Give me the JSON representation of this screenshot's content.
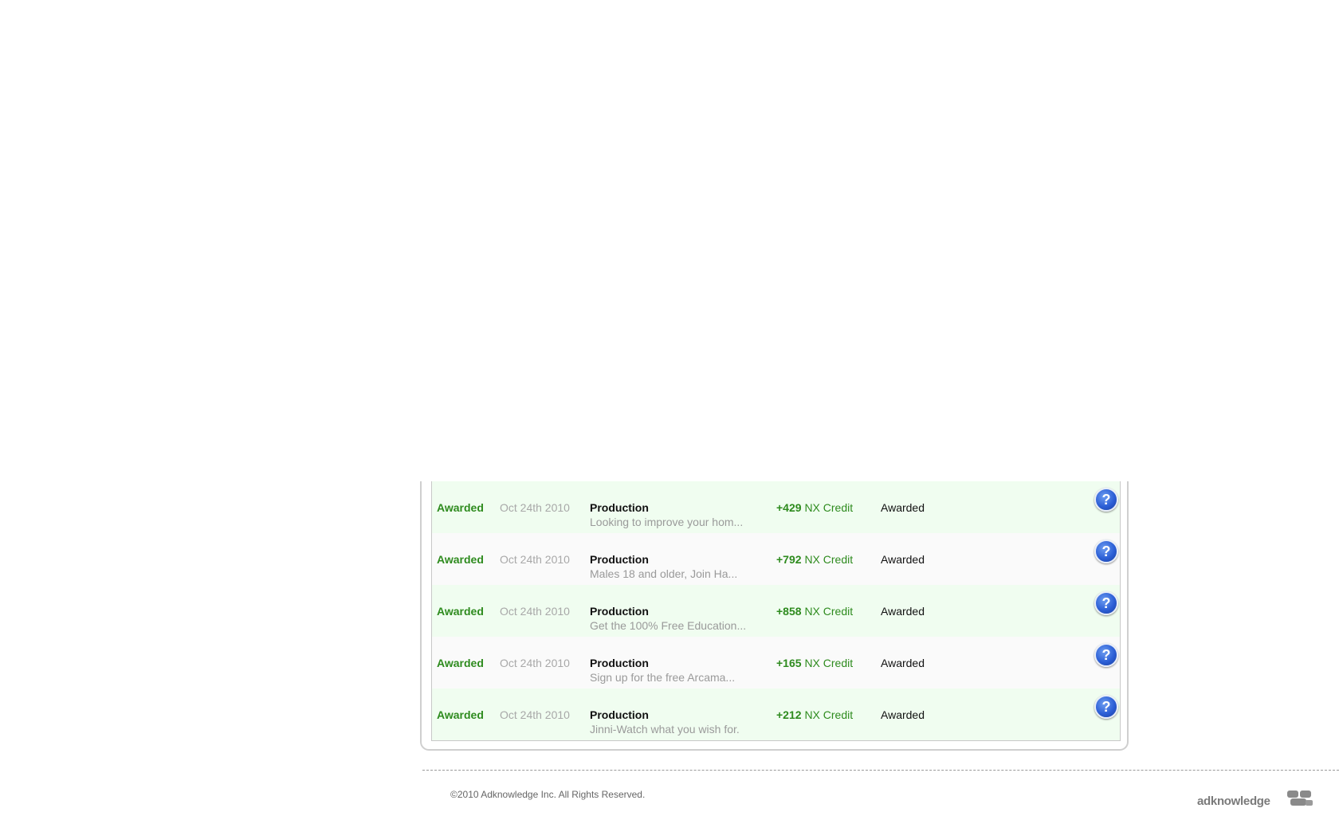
{
  "rows": [
    {
      "status": "Awarded",
      "date": "Oct 24th 2010",
      "offer_name": "Production",
      "offer_desc": "Looking to improve your hom...",
      "credit_amount": "+429",
      "credit_unit": "NX Credit",
      "credit_status": "Awarded",
      "help_icon": "?"
    },
    {
      "status": "Awarded",
      "date": "Oct 24th 2010",
      "offer_name": "Production",
      "offer_desc": "Males 18 and older, Join Ha...",
      "credit_amount": "+792",
      "credit_unit": "NX Credit",
      "credit_status": "Awarded",
      "help_icon": "?"
    },
    {
      "status": "Awarded",
      "date": "Oct 24th 2010",
      "offer_name": "Production",
      "offer_desc": "Get the 100% Free Education...",
      "credit_amount": "+858",
      "credit_unit": "NX Credit",
      "credit_status": "Awarded",
      "help_icon": "?"
    },
    {
      "status": "Awarded",
      "date": "Oct 24th 2010",
      "offer_name": "Production",
      "offer_desc": "Sign up for the free Arcama...",
      "credit_amount": "+165",
      "credit_unit": "NX Credit",
      "credit_status": "Awarded",
      "help_icon": "?"
    },
    {
      "status": "Awarded",
      "date": "Oct 24th 2010",
      "offer_name": "Production",
      "offer_desc": "Jinni-Watch what you wish for.",
      "credit_amount": "+212",
      "credit_unit": "NX Credit",
      "credit_status": "Awarded",
      "help_icon": "?"
    }
  ],
  "footer": {
    "copyright": "©2010 Adknowledge Inc. All Rights Reserved.",
    "logo_text": "adknowledge"
  },
  "colors": {
    "awarded_green": "#2e8b1e",
    "row_tint": "#f0fdf0",
    "help_blue": "#2c5fd6"
  },
  "icons": {
    "help": "help-icon",
    "logo": "adknowledge-logo-icon"
  }
}
